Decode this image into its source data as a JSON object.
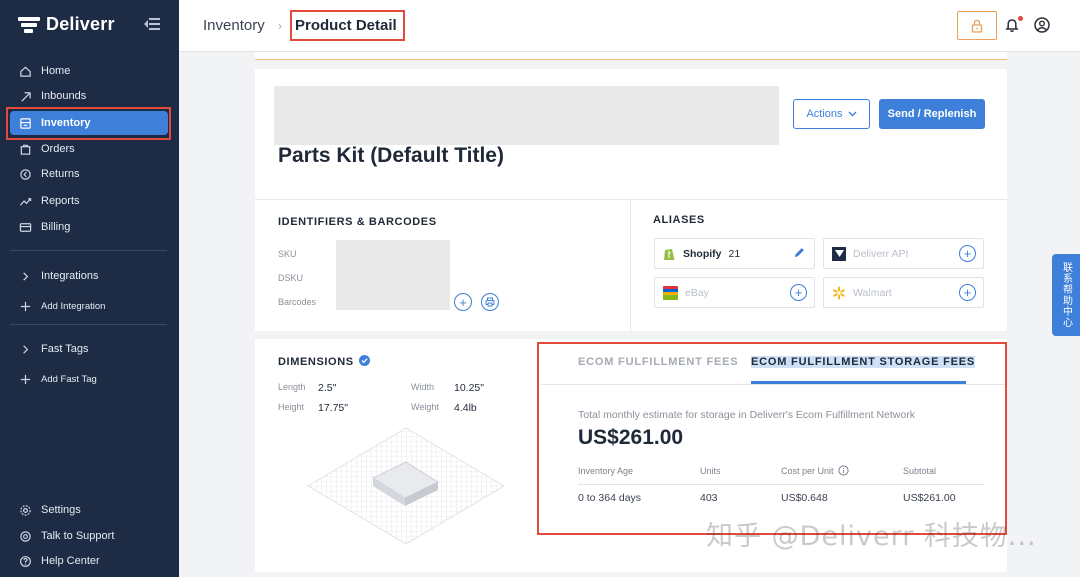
{
  "brand": {
    "name": "Deliverr"
  },
  "sidebar": {
    "items": [
      {
        "label": "Home",
        "icon": "home-icon"
      },
      {
        "label": "Inbounds",
        "icon": "inbounds-icon"
      },
      {
        "label": "Inventory",
        "icon": "inventory-icon",
        "active": true
      },
      {
        "label": "Orders",
        "icon": "orders-icon"
      },
      {
        "label": "Returns",
        "icon": "returns-icon"
      },
      {
        "label": "Reports",
        "icon": "reports-icon"
      },
      {
        "label": "Billing",
        "icon": "billing-icon"
      }
    ],
    "integrations_label": "Integrations",
    "add_integration_label": "Add Integration",
    "fast_tags_label": "Fast Tags",
    "add_fast_tag_label": "Add Fast Tag",
    "settings_label": "Settings",
    "talk_to_support_label": "Talk to Support",
    "help_center_label": "Help Center"
  },
  "header": {
    "breadcrumb_parent": "Inventory",
    "breadcrumb_separator": "›",
    "breadcrumb_current": "Product Detail"
  },
  "product": {
    "title": "Parts Kit (Default Title)",
    "actions_label": "Actions",
    "send_label": "Send / Replenish"
  },
  "identifiers": {
    "heading": "IDENTIFIERS & BARCODES",
    "sku_label": "SKU",
    "dsku_label": "DSKU",
    "barcodes_label": "Barcodes"
  },
  "aliases": {
    "heading": "ALIASES",
    "items": [
      {
        "name": "Shopify",
        "count": "21",
        "enabled": true
      },
      {
        "name": "Deliverr API",
        "enabled": false
      },
      {
        "name": "eBay",
        "enabled": false
      },
      {
        "name": "Walmart",
        "enabled": false
      }
    ]
  },
  "dimensions": {
    "heading": "DIMENSIONS",
    "length_label": "Length",
    "length_value": "2.5\"",
    "width_label": "Width",
    "width_value": "10.25\"",
    "height_label": "Height",
    "height_value": "17.75\"",
    "weight_label": "Weight",
    "weight_value": "4.4lb"
  },
  "fees": {
    "tabs": [
      "ECOM FULFILLMENT FEES",
      "ECOM FULFILLMENT STORAGE FEES"
    ],
    "active_tab": 1,
    "estimate_label": "Total monthly estimate for storage in Deliverr's Ecom Fulfillment Network",
    "estimate_value": "US$261.00",
    "columns": [
      "Inventory Age",
      "Units",
      "Cost per Unit",
      "Subtotal"
    ],
    "rows": [
      [
        "0 to 364 days",
        "403",
        "US$0.648",
        "US$261.00"
      ]
    ]
  },
  "support_tab_label": "联系帮助中心",
  "watermark": "知乎 @Deliverr 科技物...",
  "colors": {
    "sidebar_bg": "#1d2b45",
    "accent": "#3d7fd9",
    "highlight": "#e24a3b"
  }
}
